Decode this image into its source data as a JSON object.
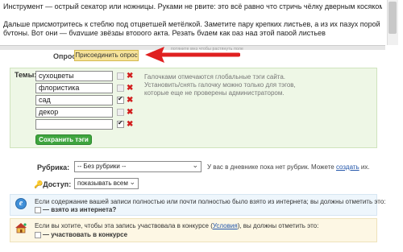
{
  "editor": {
    "line1": "Инструмент — острый секатор или ножницы. Руками не рвите: это всё равно что стричь чёлку дверным косяком. И флоксу обидно, и стеблю не полезно.",
    "line2": "Дальше присмотритесь к стеблю под отцветшей метёлкой. Заметите пару крепких листьев, а из их пазух порой уже лезут малютки-",
    "line3": "бутоны. Вот они — будущие звёзды второго акта. Резать будем как раз над этой парой листьев",
    "resize_hint": "потяните мнз чтобы растянуть поле"
  },
  "poll": {
    "label": "Опрос:",
    "button": "Присоединить опрос"
  },
  "tags": {
    "title": "Темы:",
    "items": [
      {
        "value": "сухоцветы",
        "checked": false,
        "grey": true
      },
      {
        "value": "флористика",
        "checked": false,
        "grey": true
      },
      {
        "value": "сад",
        "checked": true,
        "grey": false
      },
      {
        "value": "декор",
        "checked": false,
        "grey": true
      },
      {
        "value": "",
        "checked": true,
        "grey": false
      }
    ],
    "delete_glyph": "✖",
    "hint": "Галочками отмечаются глобальные тэги сайта. Установить/снять галочку можно только для тэгов, которые еще не проверены администратором.",
    "save_button": "Сохранить тэги"
  },
  "rubric": {
    "label": "Рубрика:",
    "selected": "-- Без рубрики --",
    "note_prefix": "У вас в дневнике пока нет рубрик. Можете",
    "note_link": "создать",
    "note_suffix": "их."
  },
  "access": {
    "key_glyph": "🔑",
    "label": "Доступ:",
    "selected": "показывать всем"
  },
  "internet": {
    "icon": "internet-explorer-icon",
    "text": "Если содержание вашей записи полностью или почти полностью было взято из интернета; вы должны отметить это:",
    "checkbox_label": "— взято из интернета?"
  },
  "contest": {
    "icon": "contest-house-icon",
    "text_prefix": "Если вы хотите, чтобы эта запись участвовала в конкурсе (",
    "text_link": "Условия",
    "text_suffix": "), вы должны отметить это:",
    "checkbox_label": "— участвовать в конкурсе"
  },
  "colors": {
    "arrow": "#e02020",
    "tags_panel": "#eef7e6",
    "save_button": "#3ea53e",
    "poll_button": "#f7e39a"
  }
}
